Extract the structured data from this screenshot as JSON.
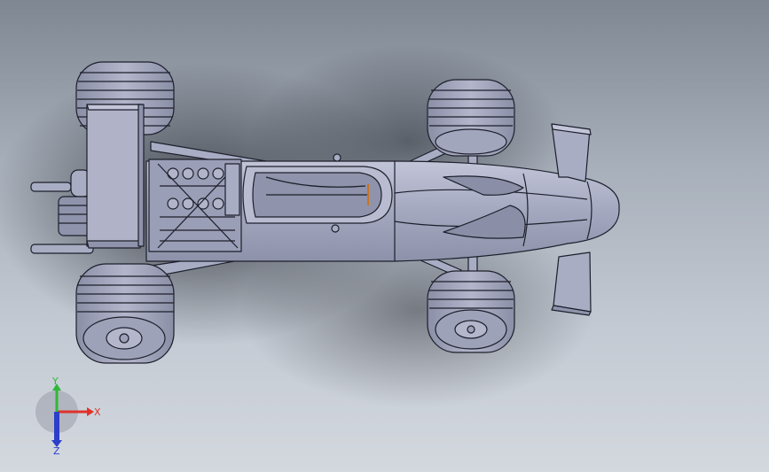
{
  "viewport": {
    "background_top": "#7f8793",
    "background_bottom": "#d3d8df",
    "model_color": "#a9adc4",
    "edge_color": "#1d1f2b"
  },
  "triad": {
    "x_label": "X",
    "y_label": "Y",
    "z_label": "Z",
    "x_color": "#e0322a",
    "y_color": "#2fb83a",
    "z_color": "#2c3fc8"
  }
}
